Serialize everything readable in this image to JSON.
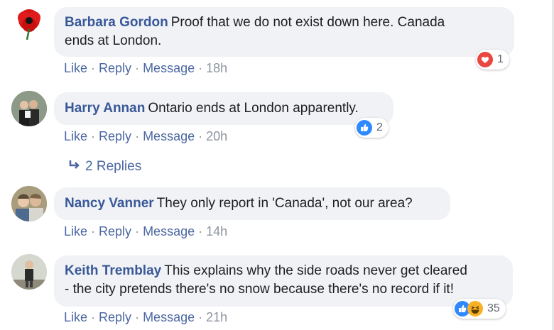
{
  "comments": [
    {
      "author": "Barbara Gordon",
      "text_line1": "Proof that we do not exist down here. Canada",
      "text_line2": "ends at London.",
      "actions": {
        "like": "Like",
        "reply": "Reply",
        "message": "Message",
        "time": "18h"
      },
      "reaction_icons": [
        "love-icon"
      ],
      "reaction_count": "1",
      "avatar_icon": "poppy-avatar"
    },
    {
      "author": "Harry Annan",
      "text_line1": "Ontario ends at London apparently.",
      "actions": {
        "like": "Like",
        "reply": "Reply",
        "message": "Message",
        "time": "20h"
      },
      "reaction_icons": [
        "like-icon"
      ],
      "reaction_count": "2",
      "avatar_icon": "couple-photo-avatar",
      "replies_label": "2 Replies"
    },
    {
      "author": "Nancy Vanner",
      "text_line1": "They only report in 'Canada', not our area?",
      "actions": {
        "like": "Like",
        "reply": "Reply",
        "message": "Message",
        "time": "14h"
      },
      "avatar_icon": "couple-photo-avatar"
    },
    {
      "author": "Keith Tremblay",
      "text_line1": "This explains why the side roads never get cleared",
      "text_line2": "- the city pretends there's no snow because there's no record if it!",
      "actions": {
        "like": "Like",
        "reply": "Reply",
        "message": "Message",
        "time": "21h"
      },
      "reaction_icons": [
        "like-icon",
        "haha-icon"
      ],
      "reaction_count": "35",
      "avatar_icon": "person-photo-avatar"
    }
  ],
  "colors": {
    "author": "#385898",
    "bubble": "#f0f2f5",
    "action_link": "#4b67a1",
    "meta": "#8d949e",
    "love": "#e9473f",
    "like": "#2e89ff",
    "haha": "#f7b125"
  }
}
